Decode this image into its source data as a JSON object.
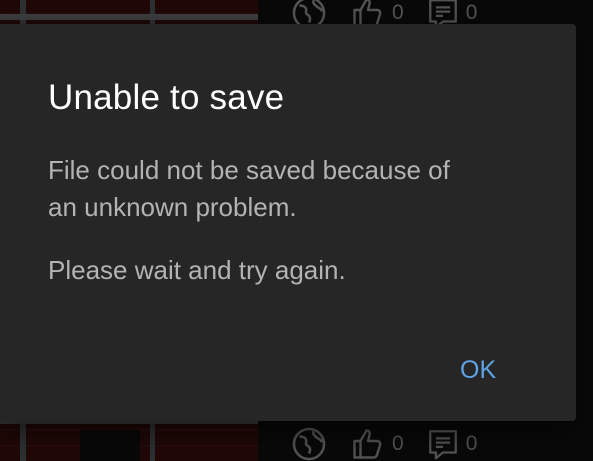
{
  "feed": {
    "top_row": {
      "like_count": "0",
      "comment_count": "0"
    },
    "bottom_row": {
      "like_count": "0",
      "comment_count": "0"
    },
    "icons": [
      "globe-icon",
      "thumbs-up-icon",
      "comment-icon"
    ]
  },
  "dialog": {
    "title": "Unable to save",
    "message_line1": "File could not be saved because of",
    "message_line2": "an unknown problem.",
    "message_secondary": "Please wait and try again.",
    "ok_label": "OK"
  },
  "colors": {
    "dialog_bg": "#262626",
    "accent": "#5ea3e6",
    "title": "#ffffff",
    "body_text": "#b3b3b3"
  }
}
